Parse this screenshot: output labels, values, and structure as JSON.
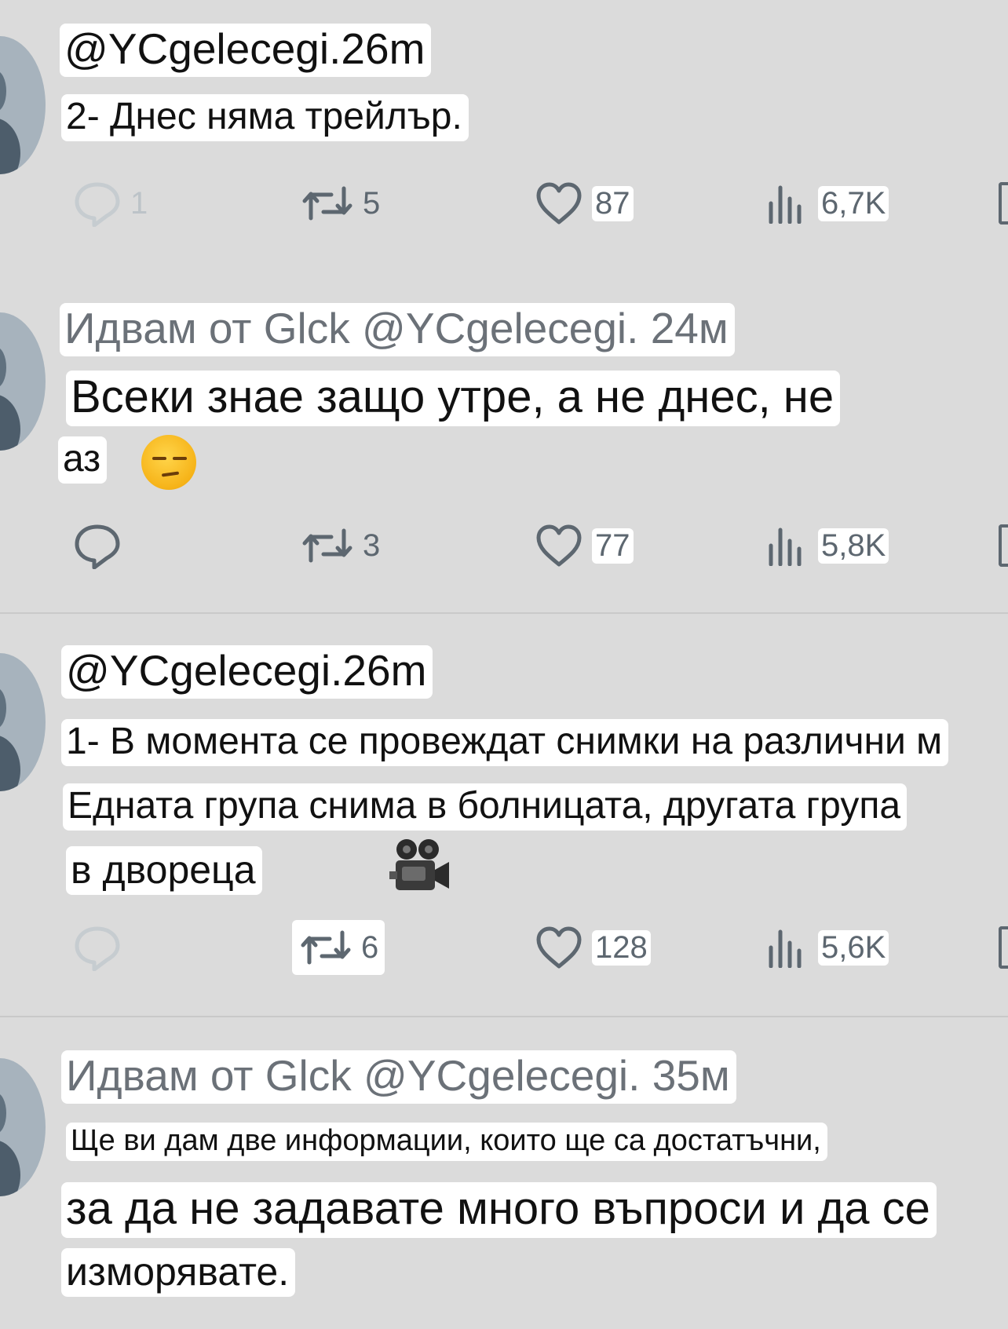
{
  "tweets": [
    {
      "header": "@YCgelecegi.26m",
      "lines": [
        "2- Днес няма трейлър."
      ],
      "actions": {
        "reply": "1",
        "retweet": "5",
        "like": "87",
        "views": "6,7K"
      }
    },
    {
      "header": "Идвам от Glck @YCgelecegi. 24м",
      "lines": [
        "Всеки знае защо утре, а не днес, не",
        "аз"
      ],
      "emoji": "unamused-face",
      "actions": {
        "reply": "",
        "retweet": "3",
        "like": "77",
        "views": "5,8K"
      }
    },
    {
      "header": "@YCgelecegi.26m",
      "lines": [
        "1- В момента се провеждат снимки на различни м",
        "Едната група снима в болницата, другата група",
        "в двореца"
      ],
      "emoji": "movie-camera",
      "actions": {
        "reply": "",
        "retweet": "6",
        "like": "128",
        "views": "5,6K"
      }
    },
    {
      "header": "Идвам от Glck @YCgelecegi. 35м",
      "lines": [
        "Ще ви дам две информации, които ще са достатъчни,",
        "за да не задавате много въпроси и да се",
        "изморявате."
      ]
    }
  ],
  "icons": [
    "reply-icon",
    "retweet-icon",
    "like-icon",
    "views-icon",
    "bookmark-icon"
  ],
  "colors": {
    "background": "#dbdbdb",
    "icon": "#5d6770",
    "muted_text": "#6b7178"
  }
}
